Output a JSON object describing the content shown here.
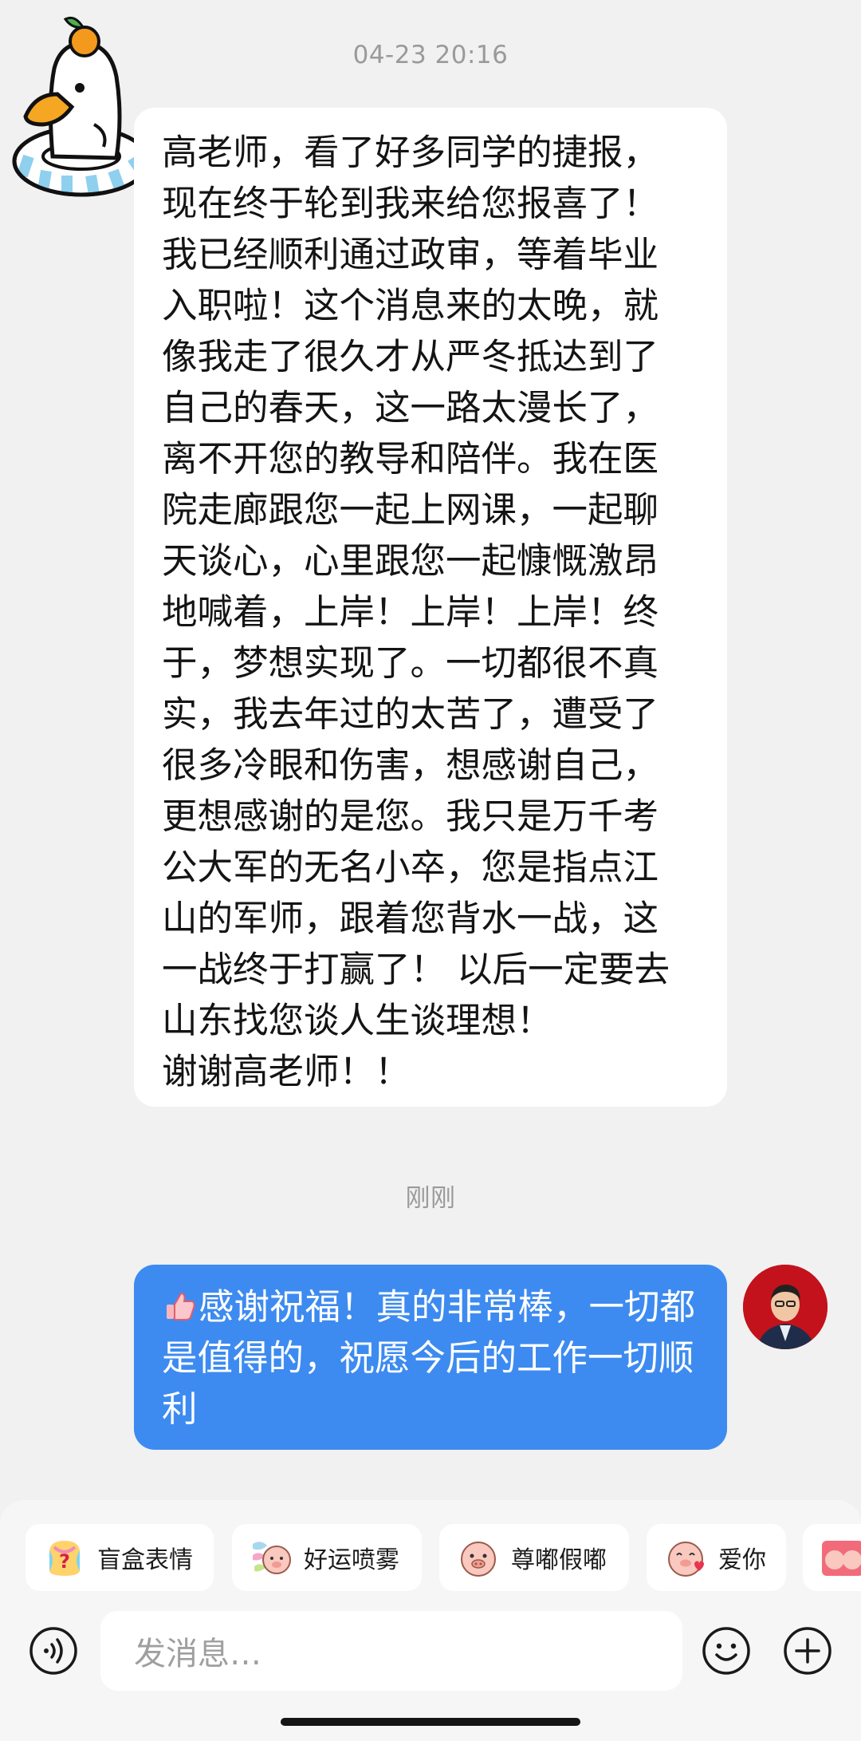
{
  "conversation": {
    "timestamp_1": "04-23 20:16",
    "incoming_message": "高老师，看了好多同学的捷报，\n现在终于轮到我来给您报喜了！\n我已经顺利通过政审，等着毕业\n入职啦！这个消息来的太晚，就\n像我走了很久才从严冬抵达到了\n自己的春天，这一路太漫长了，\n离不开您的教导和陪伴。我在医\n院走廊跟您一起上网课，一起聊\n天谈心，心里跟您一起慷慨激昂\n地喊着，上岸！上岸！上岸！终\n于，梦想实现了。一切都很不真\n实，我去年过的太苦了，遭受了\n很多冷眼和伤害，想感谢自己，\n更想感谢的是您。我只是万千考\n公大军的无名小卒，您是指点江\n山的军师，跟着您背水一战，这\n一战终于打赢了！ 以后一定要去\n山东找您谈人生谈理想！\n谢谢高老师！！",
    "timestamp_2": "刚刚",
    "outgoing_message": "感谢祝福！真的非常棒，一切都是值得的，祝愿今后的工作一切顺利",
    "incoming_avatar_icon": "duck-with-orange-icon",
    "outgoing_avatar_icon": "teacher-photo-avatar",
    "outgoing_prefix_icon": "thumbs-up-icon"
  },
  "sticker_chips": [
    {
      "label": "盲盒表情",
      "icon": "blind-box-emoji-icon"
    },
    {
      "label": "好运喷雾",
      "icon": "lucky-spray-emoji-icon"
    },
    {
      "label": "尊嘟假嘟",
      "icon": "pig-face-emoji-icon"
    },
    {
      "label": "爱你",
      "icon": "pig-heart-emoji-icon"
    }
  ],
  "composer": {
    "placeholder": "发消息…",
    "voice_icon": "voice-icon",
    "emoji_icon": "smiley-icon",
    "plus_icon": "plus-icon"
  },
  "colors": {
    "background": "#f1f1f1",
    "incoming_bubble": "#ffffff",
    "outgoing_bubble": "#3d8bf0",
    "timestamp": "#9a9a9a"
  }
}
